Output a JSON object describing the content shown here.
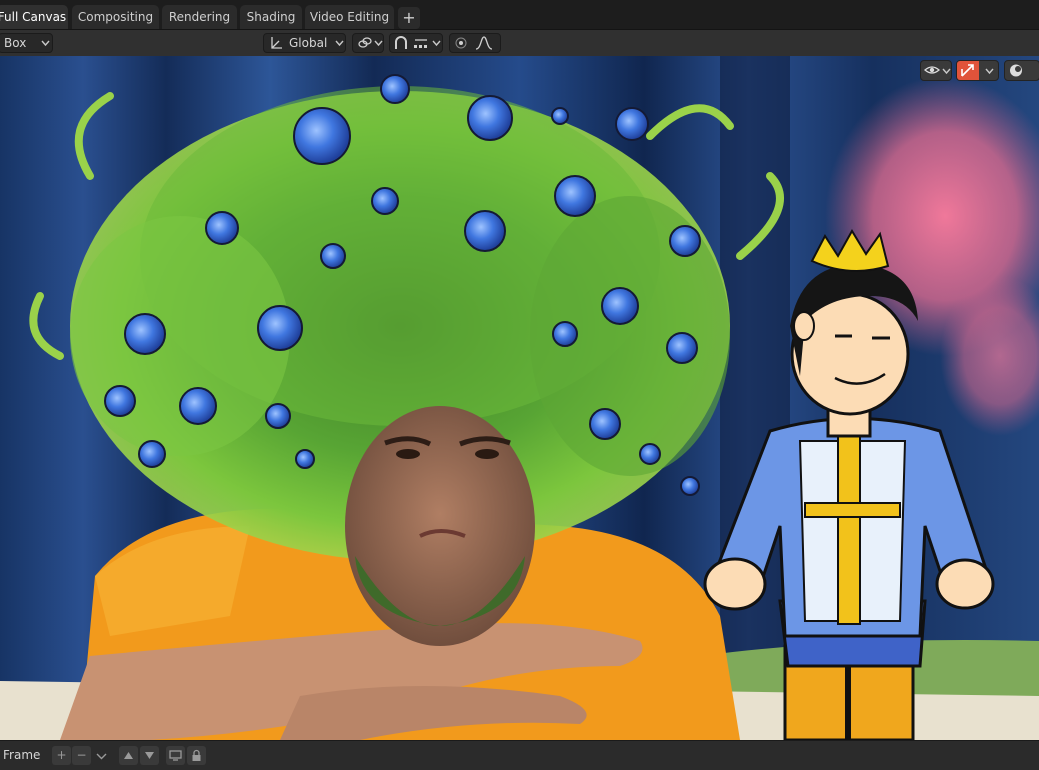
{
  "workspace_tabs": [
    {
      "label": "Full Canvas",
      "active": true
    },
    {
      "label": "Compositing",
      "active": false
    },
    {
      "label": "Rendering",
      "active": false
    },
    {
      "label": "Shading",
      "active": false
    },
    {
      "label": "Video Editing",
      "active": false
    }
  ],
  "add_workspace_label": "+",
  "toolbar": {
    "select_mode": "Box",
    "orientation": "Global",
    "icons": [
      "transform-orientation-icon",
      "pivot-link-icon",
      "snap-magnet-icon",
      "snap-increment-icon",
      "proportional-edit-icon",
      "falloff-curve-icon"
    ]
  },
  "viewport_overlays": {
    "icons": [
      "visibility-eye-icon",
      "gizmo-arrow-icon",
      "viewport-shading-icon"
    ],
    "accent_color": "#e0533a"
  },
  "footer": {
    "frame_label": "Frame",
    "add_label": "+",
    "remove_label": "−",
    "icons": [
      "add-icon",
      "remove-icon",
      "dropdown-chevron-icon",
      "move-up-icon",
      "move-down-icon",
      "screen-icon",
      "lock-icon"
    ]
  },
  "colors": {
    "ui_background": "#1d1d1d",
    "header": "#303030",
    "curtain_blue": "#1a3a6a",
    "shirt_orange": "#f29a1c",
    "foliage_green": "#5fae2f",
    "flower_blue": "#3f73d9"
  }
}
